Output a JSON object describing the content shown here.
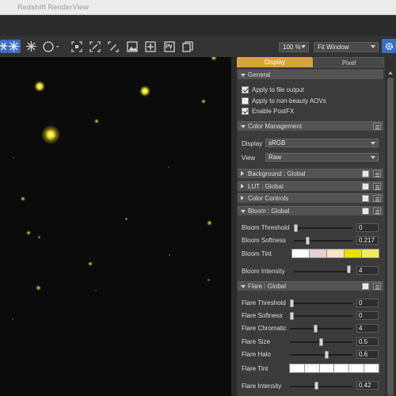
{
  "window": {
    "title": "Redshift RenderView"
  },
  "toolbar": {
    "icons": [
      "render-icon",
      "snowflake-icon",
      "circle-icon",
      "region-icon",
      "fit-icon",
      "edit-icon",
      "image-icon",
      "add-icon",
      "pv-icon",
      "copy-icon"
    ],
    "zoom": "100 %",
    "fit_mode": "Fit Window",
    "colors": {
      "active": "#3c6fbf"
    }
  },
  "tabs": [
    {
      "label": "Display",
      "active": true
    },
    {
      "label": "Pixel",
      "active": false
    }
  ],
  "sections": {
    "general": {
      "label": "General",
      "options": [
        {
          "label": "Apply to file output",
          "checked": true
        },
        {
          "label": "Apply to non-beauty AOVs",
          "checked": false
        },
        {
          "label": "Enable PostFX",
          "checked": true
        }
      ]
    },
    "color_management": {
      "label": "Color Management",
      "display_label": "Display",
      "display_value": "sRGB",
      "view_label": "View",
      "view_value": "Raw"
    },
    "background": {
      "label": "Background : Global"
    },
    "lut": {
      "label": "LUT   : Global"
    },
    "color_controls": {
      "label": "Color Controls"
    },
    "bloom": {
      "label": "Bloom : Global",
      "threshold": {
        "label": "Bloom Threshold",
        "value": "0",
        "fraction": 0.0
      },
      "softness": {
        "label": "Bloom Softness",
        "value": "0.217",
        "fraction": 0.217
      },
      "tint": {
        "label": "Bloom Tint",
        "colors": [
          "#fbfbfb",
          "#e6cfd6",
          "#f6e4c4",
          "#e8e000",
          "#f2ec5c"
        ]
      },
      "intensity": {
        "label": "Bloom Intensity",
        "value": "4",
        "fraction": 0.97
      }
    },
    "flare": {
      "label": "Flare : Global",
      "threshold": {
        "label": "Flare Threshold",
        "value": "0",
        "fraction": 0.0
      },
      "softness": {
        "label": "Flare Softness",
        "value": "0",
        "fraction": 0.0
      },
      "chromatic": {
        "label": "Flare Chromatic",
        "value": "4",
        "fraction": 0.4
      },
      "size": {
        "label": "Flare Size",
        "value": "0.5",
        "fraction": 0.5
      },
      "halo": {
        "label": "Flare Halo",
        "value": "0.6",
        "fraction": 0.6
      },
      "tint": {
        "label": "Flare Tint",
        "colors": [
          "#ffffff",
          "#ffffff",
          "#ffffff",
          "#ffffff",
          "#ffffff",
          "#ffffff"
        ]
      },
      "intensity": {
        "label": "Flare Intensity",
        "value": "0.42",
        "fraction": 0.42
      }
    }
  }
}
